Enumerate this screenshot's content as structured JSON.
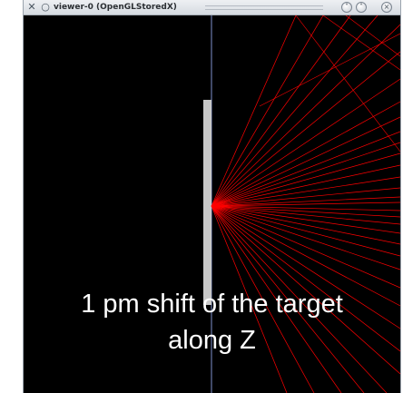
{
  "window": {
    "title": "viewer-0 (OpenGLStoredX)"
  },
  "titlebar_icons": {
    "app": "tools-icon",
    "pin": "circle-icon",
    "shade": "chevron-down-icon",
    "maximize": "chevron-up-icon",
    "close": "close-icon"
  },
  "scene": {
    "background_color": "#000000",
    "beam_color": "#ff0000",
    "target_color": "#c8c8c8",
    "axis_color": "#9fb6ff"
  },
  "caption": {
    "line1": "1 pm shift of the target",
    "line2": "along Z"
  }
}
